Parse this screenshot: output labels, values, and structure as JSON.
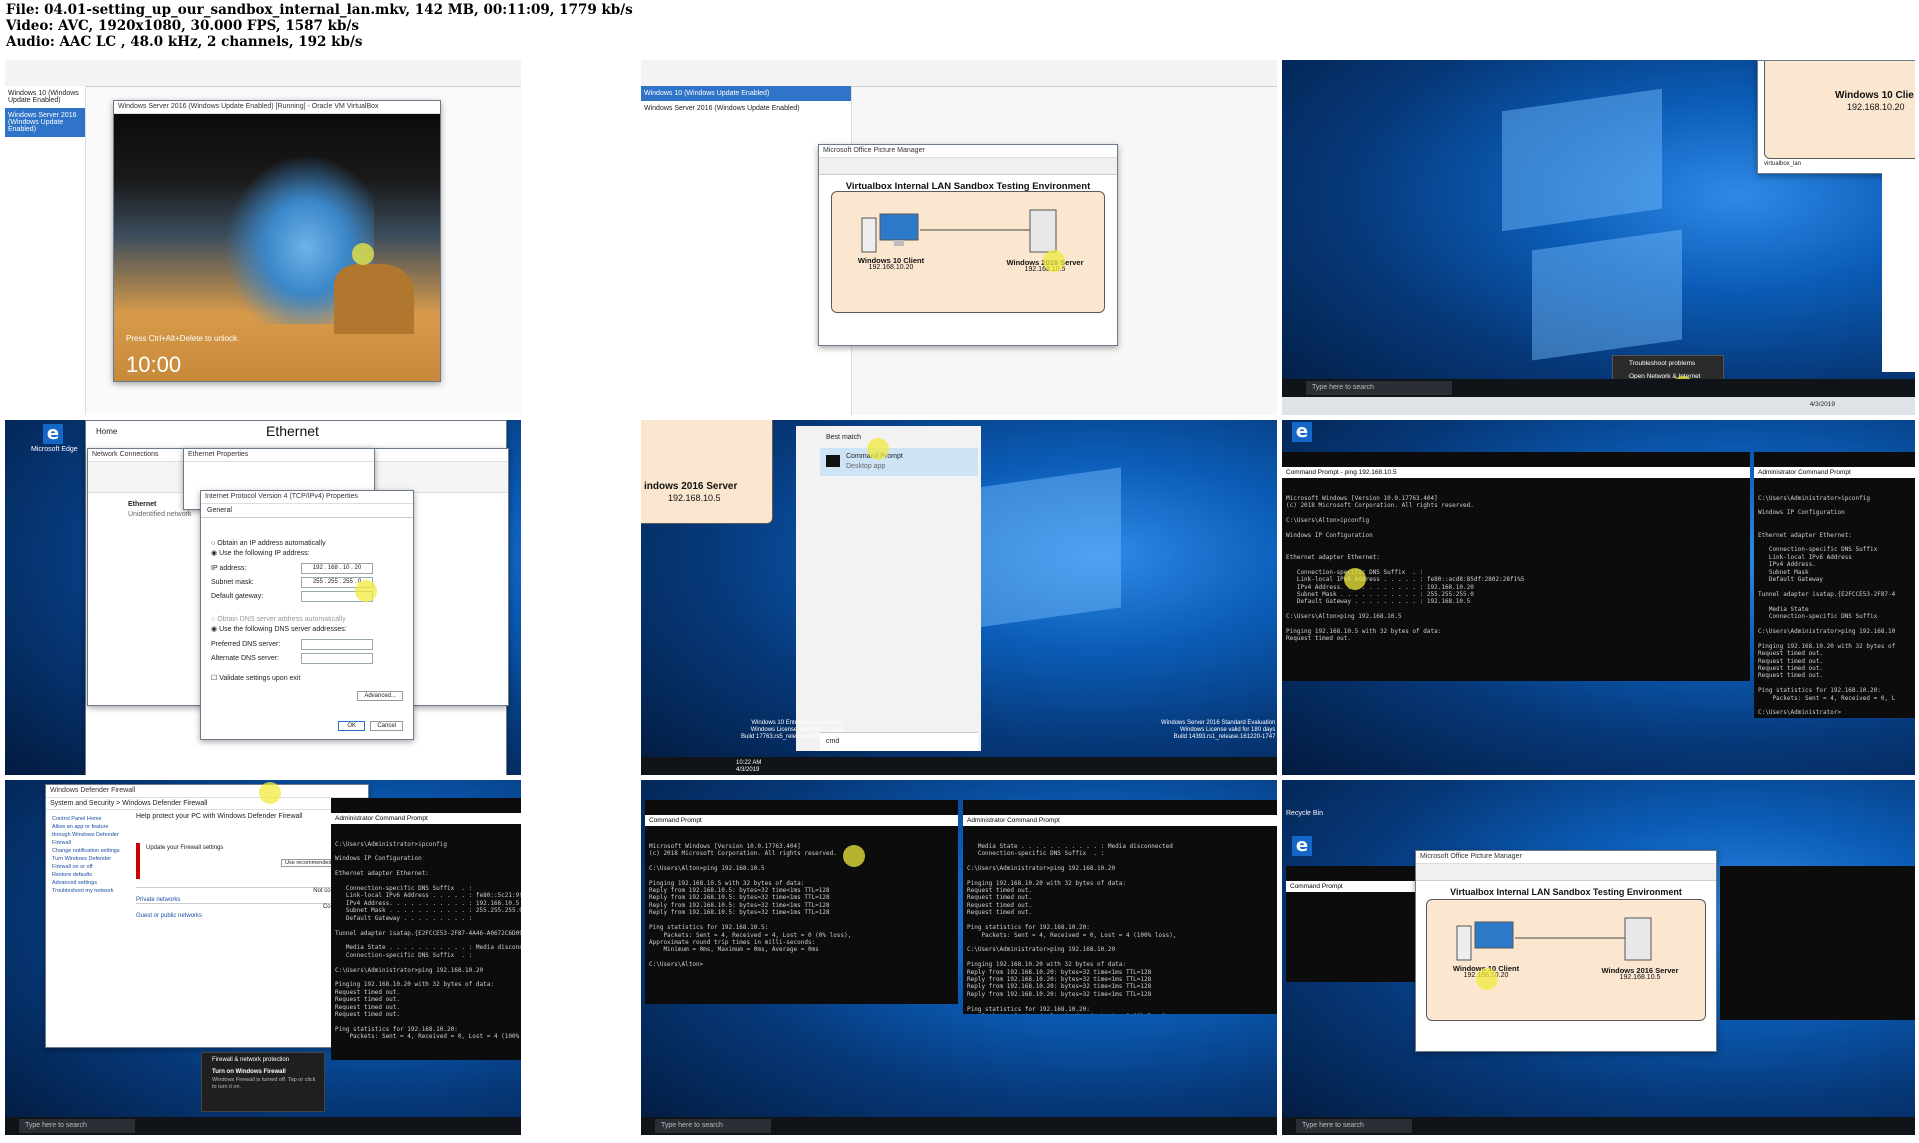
{
  "file_info": {
    "file_line": "File: 04.01-setting_up_our_sandbox_internal_lan.mkv, 142 MB, 00:11:09, 1779 kb/s",
    "video_line": "Video: AVC, 1920x1080, 30.000 FPS, 1587 kb/s",
    "audio_line": "Audio: AAC LC , 48.0 kHz, 2 channels, 192 kb/s"
  },
  "thumb1": {
    "vm_window_title": "Windows Server 2016 (Windows Update Enabled) [Running] - Oracle VM VirtualBox",
    "lock_hint": "Press Ctrl+Alt+Delete to unlock.",
    "clock": "10:00",
    "vm_list": [
      "Windows 10 (Windows Update Enabled)",
      "Windows Server 2016 (Windows Update Enabled)"
    ]
  },
  "thumb2": {
    "app_title": "Microsoft Office Picture Manager",
    "vm_list": [
      "Windows 10 (Windows Update Enabled)",
      "Windows Server 2016 (Windows Update Enabled)"
    ]
  },
  "diagram": {
    "title": "Virtualbox Internal LAN Sandbox Testing Environment",
    "client_label": "Windows 10 Client",
    "client_ip": "192.168.10.20",
    "server_label": "Windows 2016 Server",
    "server_ip": "192.168.10.5",
    "network_label": "virtualbox_lan"
  },
  "thumb3": {
    "partial_client_label": "Windows 10 Clie",
    "client_ip": "192.168.10.20",
    "network_label": "virtualbox_lan",
    "tray_menu": [
      "Troubleshoot problems",
      "Open Network & Internet settings"
    ],
    "search_placeholder": "Type here to search",
    "date": "4/3/2019"
  },
  "thumb4": {
    "edge_label": "Microsoft Edge",
    "home_label": "Home",
    "settings_heading": "Ethernet",
    "net_conn_title": "Network Connections",
    "adapter_name": "Ethernet",
    "adapter_sub": "Unidentified network",
    "eth_props_title": "Ethernet Properties",
    "ipv4_title": "Internet Protocol Version 4 (TCP/IPv4) Properties",
    "tab_general": "General",
    "auto_ip": "Obtain an IP address automatically",
    "use_ip": "Use the following IP address:",
    "ip_label": "IP address:",
    "ip_value": "192 . 168 . 10 . 20",
    "mask_label": "Subnet mask:",
    "mask_value": "255 . 255 . 255 . 0",
    "gateway_label": "Default gateway:",
    "auto_dns": "Obtain DNS server address automatically",
    "use_dns": "Use the following DNS server addresses:",
    "pref_dns": "Preferred DNS server:",
    "alt_dns": "Alternate DNS server:",
    "validate": "Validate settings upon exit",
    "advanced": "Advanced...",
    "ok": "OK",
    "cancel": "Cancel",
    "partial_server_label": "indows 2016 Server",
    "partial_server_ip": "192.168.10.5",
    "partial_win": "Win",
    "network_label": "virtualbox_lan"
  },
  "thumb5": {
    "best_match": "Best match",
    "result_name": "Command Prompt",
    "result_sub": "Desktop app",
    "search_text": "cmd",
    "watermark_left": [
      "Windows 10 Enterprise Evaluation",
      "Windows License valid for 90 days",
      "Build 17763.rs5_release.180914-1434"
    ],
    "watermark_right": [
      "Windows Server 2016 Standard Evaluation",
      "Windows License valid for 180 days",
      "Build 14393.rs1_release.161220-1747"
    ],
    "time": "10:22 AM",
    "date": "4/3/2019"
  },
  "thumb6": {
    "cmd_title": "Command Prompt - ping 192.168.10.5",
    "cmd_lines": [
      "Microsoft Windows [Version 10.0.17763.404]",
      "(c) 2018 Microsoft Corporation. All rights reserved.",
      "",
      "C:\\Users\\Alton>ipconfig",
      "",
      "Windows IP Configuration",
      "",
      "",
      "Ethernet adapter Ethernet:",
      "",
      "   Connection-specific DNS Suffix  . :",
      "   Link-local IPv6 Address . . . . . : fe80::acd8:85df:2802:28f1%5",
      "   IPv4 Address. . . . . . . . . . . : 192.168.10.20",
      "   Subnet Mask . . . . . . . . . . . : 255.255.255.0",
      "   Default Gateway . . . . . . . . . : 192.168.10.5",
      "",
      "C:\\Users\\Alton>ping 192.168.10.5",
      "",
      "Pinging 192.168.10.5 with 32 bytes of data:",
      "Request timed out."
    ],
    "admin_title": "Administrator Command Prompt",
    "admin_lines": [
      "C:\\Users\\Administrator>ipconfig",
      "",
      "Windows IP Configuration",
      "",
      "",
      "Ethernet adapter Ethernet:",
      "",
      "   Connection-specific DNS Suffix",
      "   Link-local IPv6 Address",
      "   IPv4 Address.",
      "   Subnet Mask",
      "   Default Gateway",
      "",
      "Tunnel adapter isatap.{E2FCCE53-2F87-4",
      "",
      "   Media State",
      "   Connection-specific DNS Suffix",
      "",
      "C:\\Users\\Administrator>ping 192.168.10",
      "",
      "Pinging 192.168.10.20 with 32 bytes of",
      "Request timed out.",
      "Request timed out.",
      "Request timed out.",
      "Request timed out.",
      "",
      "Ping statistics for 192.168.10.20:",
      "    Packets: Sent = 4, Received = 0, L",
      "",
      "C:\\Users\\Administrator>"
    ]
  },
  "thumb7": {
    "firewall_title": "Windows Defender Firewall",
    "breadcrumb": "System and Security > Windows Defender Firewall",
    "heading": "Help protect your PC with Windows Defender Firewall",
    "left_links": [
      "Control Panel Home",
      "Allow an app or feature through Windows Defender Firewall",
      "Change notification settings",
      "Turn Windows Defender Firewall on or off",
      "Restore defaults",
      "Advanced settings",
      "Troubleshoot my network"
    ],
    "update_settings": "Update your Firewall settings",
    "use_recommended": "Use recommended settings",
    "private_networks": "Private networks",
    "private_status": "Not connected",
    "guest_networks": "Guest or public networks",
    "guest_status": "Connected",
    "toast_title": "Firewall & network protection",
    "toast_heading": "Turn on Windows Firewall",
    "toast_body": "Windows Firewall is turned off. Tap or click to turn it on.",
    "search_placeholder": "Type here to search",
    "admin_title": "Administrator Command Prompt",
    "admin_lines": [
      "C:\\Users\\Administrator>ipconfig",
      "",
      "Windows IP Configuration",
      "",
      "Ethernet adapter Ethernet:",
      "",
      "   Connection-specific DNS Suffix  . :",
      "   Link-local IPv6 Address . . . . . : fe80::5c21:9f47:935b:8662%4",
      "   IPv4 Address. . . . . . . . . . . : 192.168.10.5",
      "   Subnet Mask . . . . . . . . . . . : 255.255.255.0",
      "   Default Gateway . . . . . . . . . :",
      "",
      "Tunnel adapter isatap.{E2FCCE53-2F87-4A46-A0672C6D09D6}:",
      "",
      "   Media State . . . . . . . . . . . : Media disconnected",
      "   Connection-specific DNS Suffix  . :",
      "",
      "C:\\Users\\Administrator>ping 192.168.10.20",
      "",
      "Pinging 192.168.10.20 with 32 bytes of data:",
      "Request timed out.",
      "Request timed out.",
      "Request timed out.",
      "Request timed out.",
      "",
      "Ping statistics for 192.168.10.20:",
      "    Packets: Sent = 4, Received = 0, Lost = 4 (100% loss),"
    ]
  },
  "thumb8": {
    "cmd_title": "Command Prompt",
    "cmd_lines": [
      "Microsoft Windows [Version 10.0.17763.404]",
      "(c) 2018 Microsoft Corporation. All rights reserved.",
      "",
      "C:\\Users\\Alton>ping 192.168.10.5",
      "",
      "Pinging 192.168.10.5 with 32 bytes of data:",
      "Reply from 192.168.10.5: bytes=32 time<1ms TTL=128",
      "Reply from 192.168.10.5: bytes=32 time<1ms TTL=128",
      "Reply from 192.168.10.5: bytes=32 time<1ms TTL=128",
      "Reply from 192.168.10.5: bytes=32 time<1ms TTL=128",
      "",
      "Ping statistics for 192.168.10.5:",
      "    Packets: Sent = 4, Received = 4, Lost = 0 (0% loss),",
      "Approximate round trip times in milli-seconds:",
      "    Minimum = 0ms, Maximum = 0ms, Average = 0ms",
      "",
      "C:\\Users\\Alton>"
    ],
    "admin_title": "Administrator Command Prompt",
    "admin_lines": [
      "   Media State . . . . . . . . . . . : Media disconnected",
      "   Connection-specific DNS Suffix  . :",
      "",
      "C:\\Users\\Administrator>ping 192.168.10.20",
      "",
      "Pinging 192.168.10.20 with 32 bytes of data:",
      "Request timed out.",
      "Request timed out.",
      "Request timed out.",
      "Request timed out.",
      "",
      "Ping statistics for 192.168.10.20:",
      "    Packets: Sent = 4, Received = 0, Lost = 4 (100% loss),",
      "",
      "C:\\Users\\Administrator>ping 192.168.10.20",
      "",
      "Pinging 192.168.10.20 with 32 bytes of data:",
      "Reply from 192.168.10.20: bytes=32 time<1ms TTL=128",
      "Reply from 192.168.10.20: bytes=32 time<1ms TTL=128",
      "Reply from 192.168.10.20: bytes=32 time<1ms TTL=128",
      "Reply from 192.168.10.20: bytes=32 time<1ms TTL=128",
      "",
      "Ping statistics for 192.168.10.20:",
      "    Packets: Sent = 4, Received = 4, Lost = 0 (0% loss),",
      "Approximate round trip times in milli-seconds:",
      "    Minimum = 0ms, Maximum = 0ms, Average = 0ms",
      "",
      "C:\\Users\\Administrator>"
    ],
    "search_placeholder": "Type here to search"
  },
  "thumb9": {
    "recycle_bin": "Recycle Bin",
    "edge_label": "Microsoft Edge",
    "cmd_title": "Command Prompt",
    "app_title": "Microsoft Office Picture Manager",
    "search_placeholder": "Type here to search"
  },
  "colors": {
    "diagram_fill": "#fbe7d0",
    "cursor_highlight": "#f0eb3c",
    "desktop_blue": "#0b5db8"
  }
}
